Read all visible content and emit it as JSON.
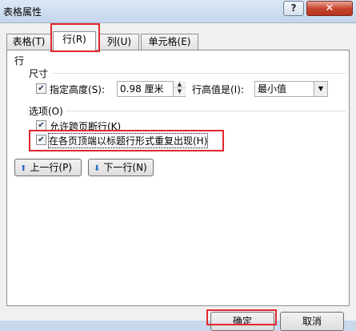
{
  "window": {
    "title": "表格属性",
    "help_label": "?",
    "close_label": "✕"
  },
  "tabs": [
    {
      "label": "表格(T)"
    },
    {
      "label": "行(R)"
    },
    {
      "label": "列(U)"
    },
    {
      "label": "单元格(E)"
    }
  ],
  "row_panel": {
    "section_title": "行",
    "size_group": "尺寸",
    "specify_height_label": "指定高度(S):",
    "specify_height_checked": true,
    "height_value": "0.98 厘米",
    "row_height_is_label": "行高值是(I):",
    "row_height_is_value": "最小值",
    "options_group": "选项(O)",
    "allow_break_label": "允许跨页断行(K)",
    "allow_break_checked": true,
    "repeat_header_label": "在各页顶端以标题行形式重复出现(H)",
    "repeat_header_checked": true,
    "prev_row_label": "上一行(P)",
    "next_row_label": "下一行(N)"
  },
  "footer": {
    "ok_label": "确定",
    "cancel_label": "取消"
  },
  "icons": {
    "check": "✔",
    "spin_up": "▲",
    "spin_down": "▼",
    "dropdown": "▼",
    "up_arrow": "⬆",
    "down_arrow": "⬇"
  }
}
